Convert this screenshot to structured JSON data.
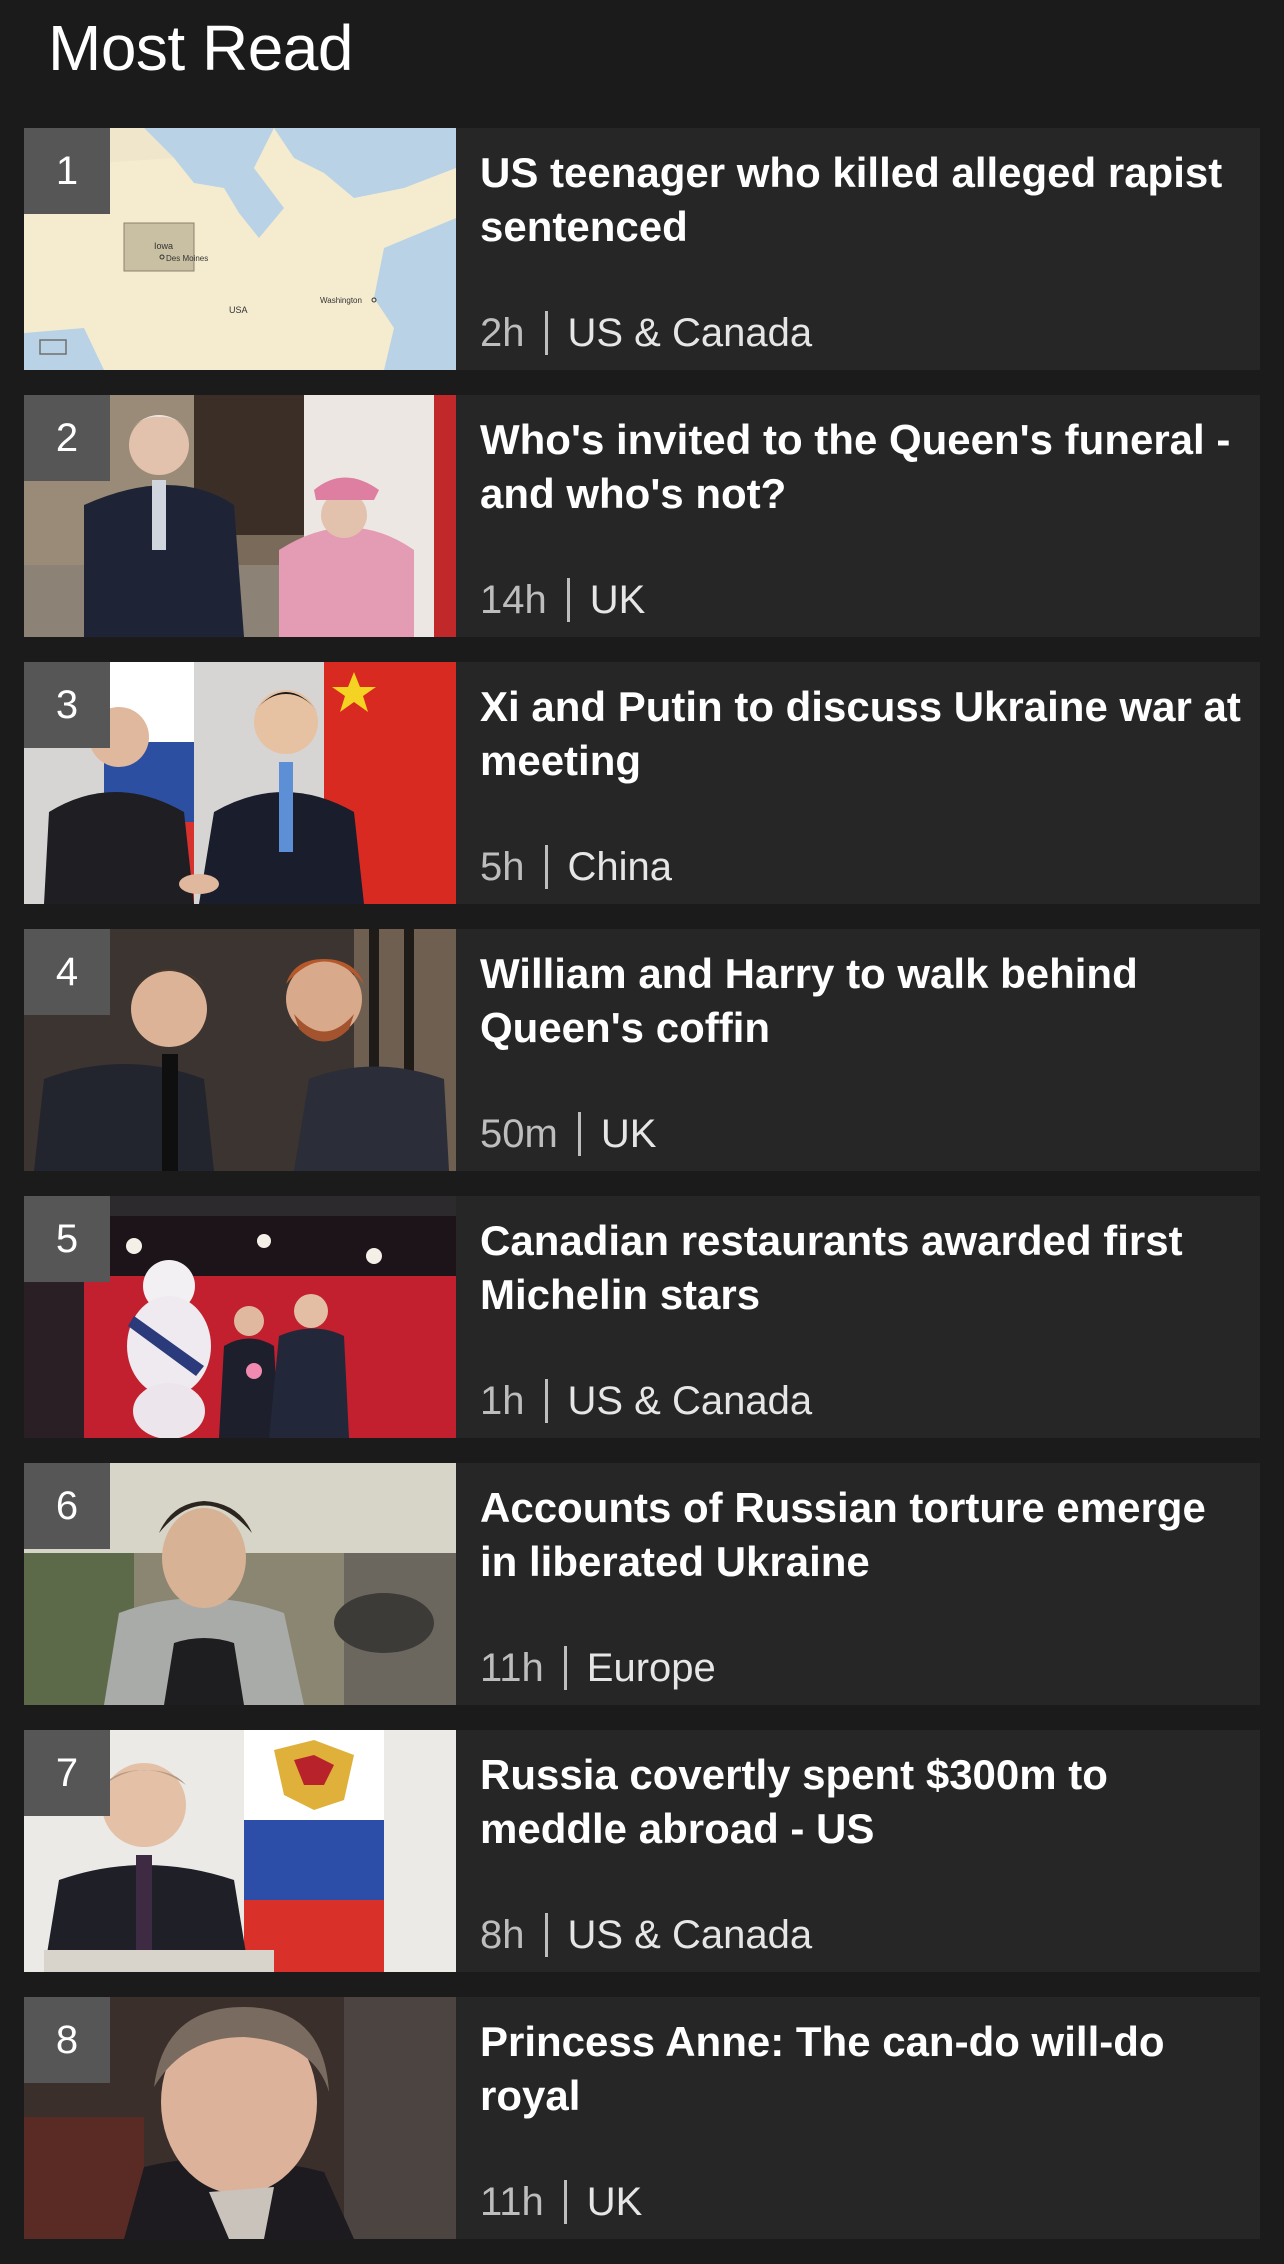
{
  "page": {
    "title": "Most Read"
  },
  "items": [
    {
      "rank": "1",
      "headline": "US teenager who killed alleged rapist sentenced",
      "time": "2h",
      "topic": "US & Canada",
      "map_labels": {
        "state": "Iowa",
        "city": "Des Moines",
        "country": "USA",
        "capital": "Washington"
      }
    },
    {
      "rank": "2",
      "headline": "Who's invited to the Queen's funeral - and who's not?",
      "time": "14h",
      "topic": "UK"
    },
    {
      "rank": "3",
      "headline": "Xi and Putin to discuss Ukraine war at meeting",
      "time": "5h",
      "topic": "China"
    },
    {
      "rank": "4",
      "headline": "William and Harry to walk behind Queen's coffin",
      "time": "50m",
      "topic": "UK"
    },
    {
      "rank": "5",
      "headline": "Canadian restaurants awarded first Michelin stars",
      "time": "1h",
      "topic": "US & Canada"
    },
    {
      "rank": "6",
      "headline": "Accounts of Russian torture emerge in liberated Ukraine",
      "time": "11h",
      "topic": "Europe"
    },
    {
      "rank": "7",
      "headline": "Russia covertly spent $300m to meddle abroad - US",
      "time": "8h",
      "topic": "US & Canada"
    },
    {
      "rank": "8",
      "headline": "Princess Anne: The can-do will-do royal",
      "time": "11h",
      "topic": "UK"
    }
  ],
  "colors": {
    "background": "#1b1b1c",
    "card": "#262627",
    "rank_badge": "#565657",
    "meta_text": "#bdbdbd"
  }
}
